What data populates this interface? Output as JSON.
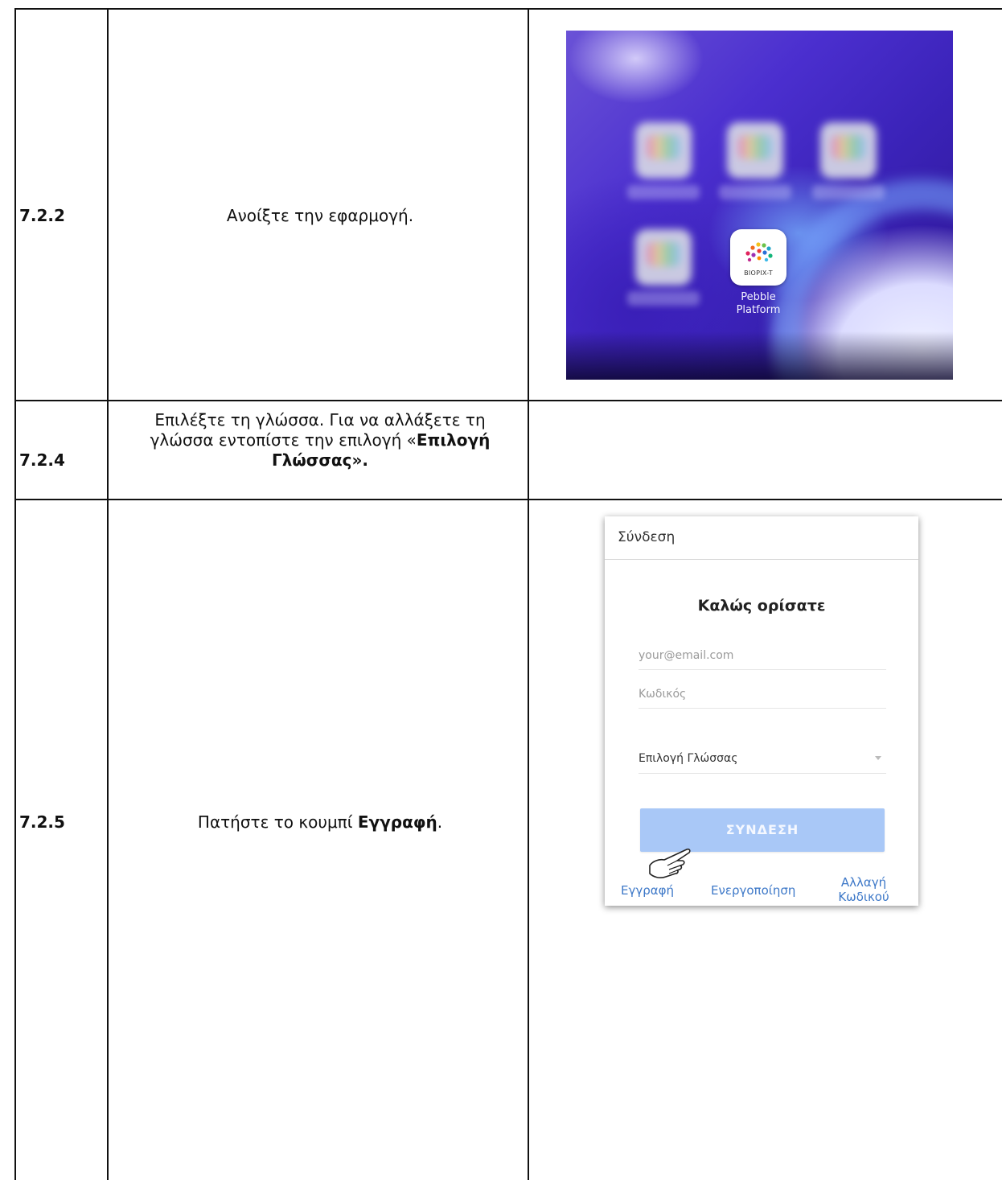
{
  "rows": [
    {
      "step": "7.2.2",
      "instruction": "Ανοίξτε την εφαρμογή."
    },
    {
      "step": "7.2.4",
      "instruction_line1": "Επιλέξτε τη γλώσσα. Για να αλλάξετε τη",
      "instruction_line2_prefix": "γλώσσα εντοπίστε την επιλογή «",
      "instruction_line2_bold": "Επιλογή",
      "instruction_line3_bold": "Γλώσσας»."
    },
    {
      "step": "7.2.5",
      "instruction_prefix": "Πατήστε το κουμπί ",
      "instruction_bold": "Εγγραφή",
      "instruction_suffix": "."
    }
  ],
  "home_screen": {
    "app_brand": "BIOPIX-T",
    "app_label_line1": "Pebble",
    "app_label_line2": "Platform"
  },
  "login_screen": {
    "header": "Σύνδεση",
    "welcome": "Καλώς ορίσατε",
    "email_placeholder": "your@email.com",
    "password_placeholder": "Κωδικός",
    "language_select": "Επιλογή Γλώσσας",
    "login_button": "ΣΥΝΔΕΣΗ",
    "footer": {
      "register": "Εγγραφή",
      "activate": "Ενεργοποίηση",
      "change_password_line1": "Αλλαγή",
      "change_password_line2": "Κωδικού"
    }
  },
  "colors": {
    "link_blue": "#3d78c8",
    "button_disabled": "#a9c8f7",
    "wallpaper_purple": "#4b2fcf"
  }
}
